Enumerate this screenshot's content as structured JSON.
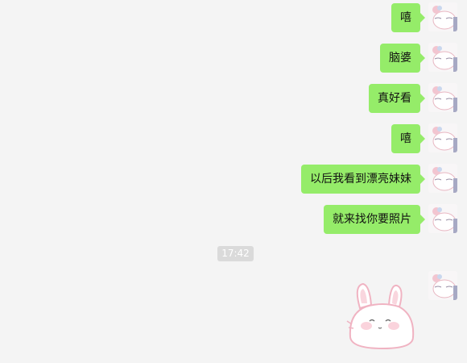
{
  "messages": [
    {
      "text": "嘻"
    },
    {
      "text": "脑婆"
    },
    {
      "text": "真好看"
    },
    {
      "text": "嘻"
    },
    {
      "text": "以后我看到漂亮妹妹"
    },
    {
      "text": "就来找你要照片"
    }
  ],
  "timestamp": "17:42",
  "colors": {
    "bubble": "#95ec69",
    "background": "#f4f4f4",
    "timestamp_bg": "#dadada"
  },
  "sticker": {
    "icon": "bunny-sticker-icon"
  }
}
